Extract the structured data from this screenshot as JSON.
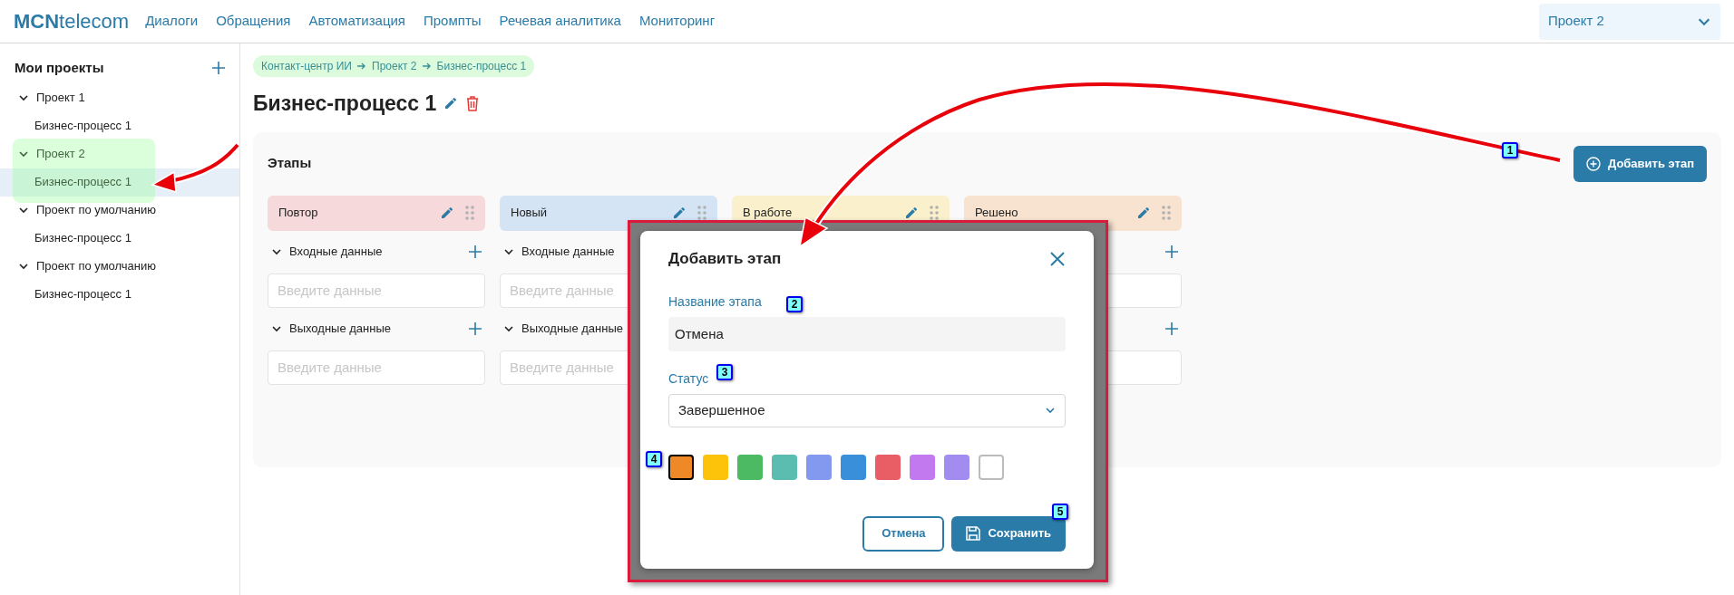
{
  "header": {
    "logo": "**MCN**telecom",
    "nav": [
      "Диалоги",
      "Обращения",
      "Автоматизация",
      "Промпты",
      "Речевая аналитика",
      "Мониторинг"
    ],
    "project_select": "Проект 2"
  },
  "sidebar": {
    "title": "Мои проекты",
    "projects": [
      {
        "label": "Проект 1",
        "expanded": true,
        "children": [
          {
            "label": "Бизнес-процесс 1",
            "selected": false
          }
        ]
      },
      {
        "label": "Проект 2",
        "expanded": true,
        "children": [
          {
            "label": "Бизнес-процесс 1",
            "selected": true
          }
        ]
      },
      {
        "label": "Проект по умолчанию",
        "expanded": true,
        "children": [
          {
            "label": "Бизнес-процесс 1",
            "selected": false
          }
        ]
      },
      {
        "label": "Проект по умолчанию",
        "expanded": true,
        "children": [
          {
            "label": "Бизнес-процесс 1",
            "selected": false
          }
        ]
      }
    ]
  },
  "main": {
    "breadcrumb": [
      "Контакт-центр ИИ",
      "Проект 2",
      "Бизнес-процесс 1"
    ],
    "title": "Бизнес-процесс 1",
    "board": {
      "heading": "Этапы",
      "add_button": "Добавить этап",
      "stages": [
        {
          "name": "Повтор",
          "color": "#f6d9da",
          "sections": [
            {
              "label": "Входные данные",
              "placeholder": "Введите данные",
              "add_button": true
            },
            {
              "label": "Выходные данные",
              "placeholder": "Введите данные",
              "add_button": true
            }
          ]
        },
        {
          "name": "Новый",
          "color": "#d4e4f4",
          "sections": [
            {
              "label": "Входные данные",
              "placeholder": "Введите данные",
              "add_button": false
            },
            {
              "label": "Выходные данные",
              "placeholder": "Введите данные",
              "add_button": false
            }
          ]
        },
        {
          "name": "В работе",
          "color": "#faf0cc"
        },
        {
          "name": "Решено",
          "color": "#f8e2d0",
          "sections": [
            {
              "add_button": true
            },
            {
              "add_button": true
            }
          ]
        }
      ]
    }
  },
  "dialog": {
    "title": "Добавить этап",
    "name_label": "Название этапа",
    "name_value": "Отмена",
    "status_label": "Статус",
    "status_value": "Завершенное",
    "colors": [
      {
        "color": "#ef8826",
        "selected": true
      },
      {
        "color": "#fdc20a",
        "selected": false
      },
      {
        "color": "#4cb963",
        "selected": false
      },
      {
        "color": "#5bbcb0",
        "selected": false
      },
      {
        "color": "#8399f0",
        "selected": false
      },
      {
        "color": "#3a8fdb",
        "selected": false
      },
      {
        "color": "#e95e65",
        "selected": false
      },
      {
        "color": "#c278ee",
        "selected": false
      },
      {
        "color": "#a28cf0",
        "selected": false
      },
      {
        "color": "#ffffff",
        "selected": false
      }
    ],
    "cancel_button": "Отмена",
    "save_button": "Сохранить"
  },
  "annotations": {
    "badges": [
      "1",
      "2",
      "3",
      "4",
      "5"
    ]
  }
}
